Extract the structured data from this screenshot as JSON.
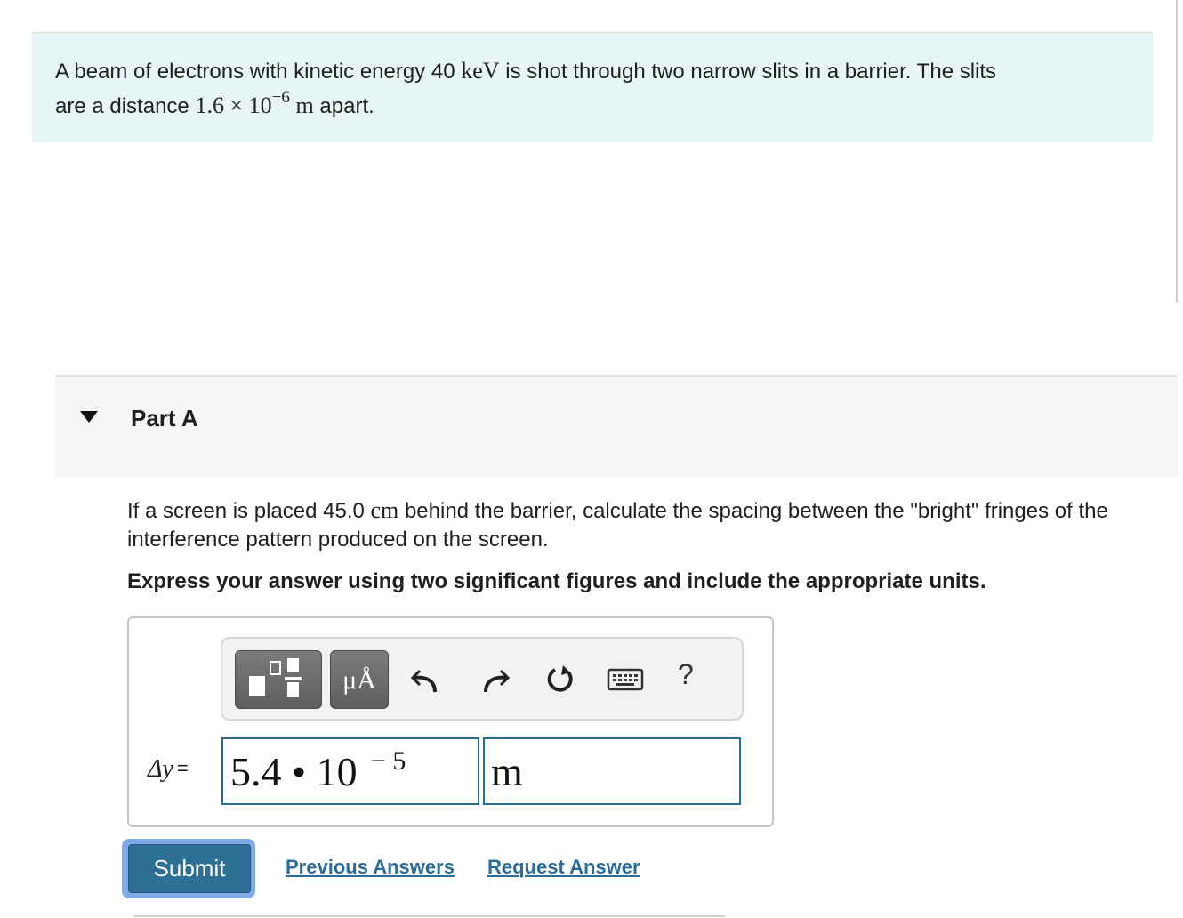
{
  "problem": {
    "text_before_energy": "A beam of electrons with kinetic energy 40",
    "energy_unit": "keV",
    "text_after_energy": "is shot through two narrow slits in a barrier. The slits",
    "line2_prefix": "are a distance",
    "distance_mantissa": "1.6 × 10",
    "distance_exponent": "−6",
    "distance_unit": "m",
    "line2_suffix": "apart."
  },
  "part": {
    "title": "Part A",
    "question_before_unit": "If a screen is placed 45.0",
    "question_unit": "cm",
    "question_after_unit": "behind the barrier, calculate the spacing between the \"bright\" fringes of the interference pattern produced on the screen.",
    "instruction": "Express your answer using two significant figures and include the appropriate units."
  },
  "toolbar": {
    "buttons": [
      {
        "name": "templates",
        "icon": "fraction-template-icon"
      },
      {
        "name": "units",
        "label": "μÅ"
      },
      {
        "name": "undo",
        "icon": "undo-icon"
      },
      {
        "name": "redo",
        "icon": "redo-icon"
      },
      {
        "name": "reset",
        "icon": "reset-icon"
      },
      {
        "name": "keyboard",
        "icon": "keyboard-icon"
      },
      {
        "name": "help",
        "label": "?"
      }
    ]
  },
  "answer": {
    "variable": "Δy",
    "equals": "=",
    "value_mantissa": "5.4 • 10",
    "value_exponent": "− 5",
    "unit": "m"
  },
  "actions": {
    "submit_label": "Submit",
    "previous_answers_label": "Previous Answers",
    "request_answer_label": "Request Answer"
  },
  "colors": {
    "problem_bg": "#e8f5f5",
    "submit_bg": "#2e6f96",
    "link": "#2a6d9c",
    "field_border": "#2a6a8e"
  }
}
